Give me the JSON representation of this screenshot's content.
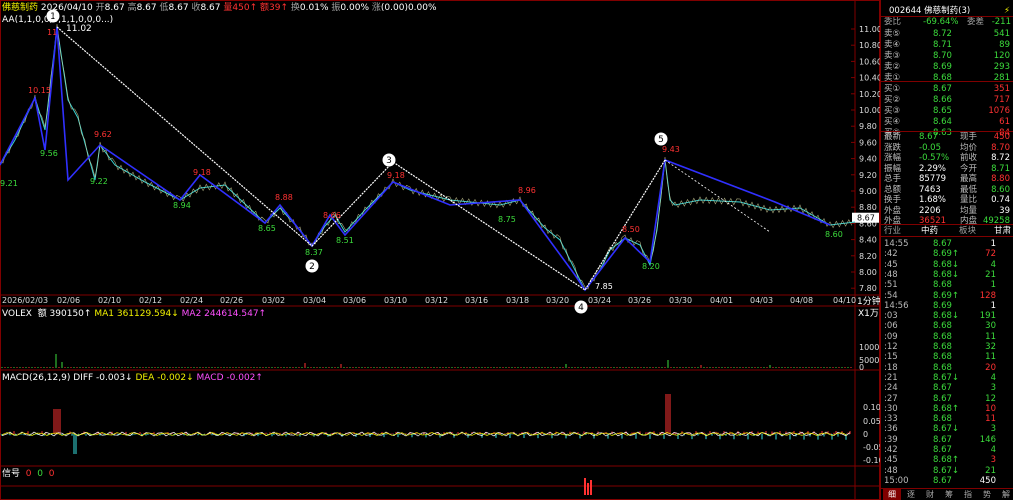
{
  "header": {
    "name": "佛慈制药",
    "date": "2026/04/10",
    "open_label": "开",
    "open": "8.67",
    "high_label": "高",
    "high": "8.67",
    "low_label": "低",
    "low": "8.67",
    "close_label": "收",
    "close": "8.67",
    "vol_label": "量",
    "vol": "450↑",
    "amount_label": "额",
    "amount": "39↑",
    "turnover_label": "换",
    "turnover": "0.01%",
    "amplitude_label": "振",
    "amplitude": "0.00%",
    "change_label": "涨",
    "change": "(0.00)0.00%"
  },
  "indicator_line": {
    "name": "AA(1,1,0,0,3,1,1,0,0,0...)",
    "value": "11.02"
  },
  "price_axis": [
    "11.00",
    "10.80",
    "10.60",
    "10.40",
    "10.20",
    "10.00",
    "9.80",
    "9.60",
    "9.40",
    "9.20",
    "9.00",
    "8.80",
    "8.60",
    "8.40",
    "8.20",
    "8.00",
    "7.80"
  ],
  "current_price_tag": "8.67",
  "date_axis": [
    "2026/02/03",
    "02/06",
    "02/10",
    "02/12",
    "02/24",
    "02/26",
    "03/02",
    "03/04",
    "03/06",
    "03/10",
    "03/12",
    "03/16",
    "03/18",
    "03/20",
    "03/24",
    "03/26",
    "03/30",
    "04/01",
    "04/03",
    "04/08",
    "04/10"
  ],
  "period_label": "1分钟",
  "wave_markers": [
    "1",
    "2",
    "3",
    "4",
    "5"
  ],
  "price_labels": [
    {
      "text": "10.15",
      "c": "red"
    },
    {
      "text": "11",
      "c": "red"
    },
    {
      "text": "9.56",
      "c": "green"
    },
    {
      "text": "9.62",
      "c": "red"
    },
    {
      "text": "9.22",
      "c": "green"
    },
    {
      "text": "9.18",
      "c": "red"
    },
    {
      "text": "8.94",
      "c": "green"
    },
    {
      "text": "8.88",
      "c": "red"
    },
    {
      "text": "8.65",
      "c": "green"
    },
    {
      "text": "8.37",
      "c": "green"
    },
    {
      "text": "8.66",
      "c": "red"
    },
    {
      "text": "8.51",
      "c": "green"
    },
    {
      "text": "9.18",
      "c": "red"
    },
    {
      "text": "8.96",
      "c": "red"
    },
    {
      "text": "8.75",
      "c": "green"
    },
    {
      "text": "7.85",
      "c": "white"
    },
    {
      "text": "8.50",
      "c": "red"
    },
    {
      "text": "8.20",
      "c": "green"
    },
    {
      "text": "9.43",
      "c": "red"
    },
    {
      "text": "8.60",
      "c": "green"
    },
    {
      "text": "9.21",
      "c": "green"
    }
  ],
  "volume": {
    "title": "VOLEX",
    "amount": "额 390150↑",
    "ma1": "MA1 361129.594↓",
    "ma2": "MA2 244614.547↑",
    "unit": "X1万",
    "axis": [
      "10000",
      "5000",
      "0"
    ]
  },
  "macd": {
    "title": "MACD(26,12,9)",
    "diff": "DIFF -0.003↓",
    "dea": "DEA -0.002↓",
    "macd": "MACD -0.002↑",
    "axis": [
      "0.10",
      "0.05",
      "0",
      "-0.05",
      "-0.10"
    ]
  },
  "signal": {
    "title": "信号",
    "v1": "0",
    "v2": "0",
    "v3": "0"
  },
  "panel": {
    "code": "002644 佛慈制药(3)",
    "wei_bi_label": "委比",
    "wei_bi": "-69.64%",
    "wei_cha_label": "委差",
    "wei_cha": "-211",
    "asks": [
      {
        "label": "卖⑤",
        "price": "8.72",
        "vol": "541"
      },
      {
        "label": "卖④",
        "price": "8.71",
        "vol": "89"
      },
      {
        "label": "卖③",
        "price": "8.70",
        "vol": "120"
      },
      {
        "label": "卖②",
        "price": "8.69",
        "vol": "293"
      },
      {
        "label": "卖①",
        "price": "8.68",
        "vol": "281"
      }
    ],
    "bids": [
      {
        "label": "买①",
        "price": "8.67",
        "vol": "351"
      },
      {
        "label": "买②",
        "price": "8.66",
        "vol": "717"
      },
      {
        "label": "买③",
        "price": "8.65",
        "vol": "1076"
      },
      {
        "label": "买④",
        "price": "8.64",
        "vol": "61"
      },
      {
        "label": "买⑤",
        "price": "8.63",
        "vol": "84"
      }
    ],
    "stats": [
      {
        "l1": "最新",
        "v1": "8.67",
        "c1": "green",
        "l2": "现手",
        "v2": "450",
        "c2": "red"
      },
      {
        "l1": "涨跌",
        "v1": "-0.05",
        "c1": "green",
        "l2": "均价",
        "v2": "8.70",
        "c2": "red"
      },
      {
        "l1": "涨幅",
        "v1": "-0.57%",
        "c1": "green",
        "l2": "前收",
        "v2": "8.72",
        "c2": "white"
      },
      {
        "l1": "振幅",
        "v1": "2.29%",
        "c1": "white",
        "l2": "今开",
        "v2": "8.71",
        "c2": "green"
      },
      {
        "l1": "总手",
        "v1": "85779",
        "c1": "white",
        "l2": "最高",
        "v2": "8.80",
        "c2": "red"
      },
      {
        "l1": "总额",
        "v1": "7463",
        "c1": "white",
        "l2": "最低",
        "v2": "8.60",
        "c2": "green"
      },
      {
        "l1": "换手",
        "v1": "1.68%",
        "c1": "white",
        "l2": "量比",
        "v2": "0.74",
        "c2": "white"
      },
      {
        "l1": "外盘",
        "v1": "2206",
        "c1": "white",
        "l2": "均量",
        "v2": "39",
        "c2": "white"
      },
      {
        "l1": "外盘",
        "v1": "36521",
        "c1": "red",
        "l2": "内盘",
        "v2": "49258",
        "c2": "green"
      }
    ],
    "industry": {
      "l": "行业",
      "v1": "中药",
      "v2": "板块",
      "v3": "甘肃"
    },
    "ticks": [
      {
        "t": "14:55",
        "p": "8.67",
        "v": "1",
        "c": "white"
      },
      {
        "t": ":42",
        "p": "8.69↑",
        "v": "72",
        "c": "red"
      },
      {
        "t": ":45",
        "p": "8.68↓",
        "v": "4",
        "c": "green"
      },
      {
        "t": ":48",
        "p": "8.68↓",
        "v": "21",
        "c": "green"
      },
      {
        "t": ":51",
        "p": "8.68",
        "v": "1",
        "c": "green"
      },
      {
        "t": ":54",
        "p": "8.69↑",
        "v": "128",
        "c": "red"
      },
      {
        "t": "14:56",
        "p": "8.69",
        "v": "1",
        "c": "white"
      },
      {
        "t": ":03",
        "p": "8.68↓",
        "v": "191",
        "c": "green"
      },
      {
        "t": ":06",
        "p": "8.68",
        "v": "30",
        "c": "green"
      },
      {
        "t": ":09",
        "p": "8.68",
        "v": "11",
        "c": "green"
      },
      {
        "t": ":12",
        "p": "8.68",
        "v": "32",
        "c": "green"
      },
      {
        "t": ":15",
        "p": "8.68",
        "v": "11",
        "c": "green"
      },
      {
        "t": ":18",
        "p": "8.68",
        "v": "20",
        "c": "red"
      },
      {
        "t": ":21",
        "p": "8.67↓",
        "v": "4",
        "c": "green"
      },
      {
        "t": ":24",
        "p": "8.67",
        "v": "3",
        "c": "green"
      },
      {
        "t": ":27",
        "p": "8.67",
        "v": "12",
        "c": "green"
      },
      {
        "t": ":30",
        "p": "8.68↑",
        "v": "10",
        "c": "red"
      },
      {
        "t": ":33",
        "p": "8.68",
        "v": "11",
        "c": "red"
      },
      {
        "t": ":36",
        "p": "8.67↓",
        "v": "3",
        "c": "green"
      },
      {
        "t": ":39",
        "p": "8.67",
        "v": "146",
        "c": "green"
      },
      {
        "t": ":42",
        "p": "8.67",
        "v": "4",
        "c": "green"
      },
      {
        "t": ":45",
        "p": "8.68↑",
        "v": "3",
        "c": "red"
      },
      {
        "t": ":48",
        "p": "8.67↓",
        "v": "21",
        "c": "green"
      },
      {
        "t": "15:00",
        "p": "8.67",
        "v": "450",
        "c": "white"
      }
    ],
    "bottom_tabs": [
      "细",
      "逐",
      "财",
      "筹",
      "指",
      "势",
      "解"
    ]
  }
}
